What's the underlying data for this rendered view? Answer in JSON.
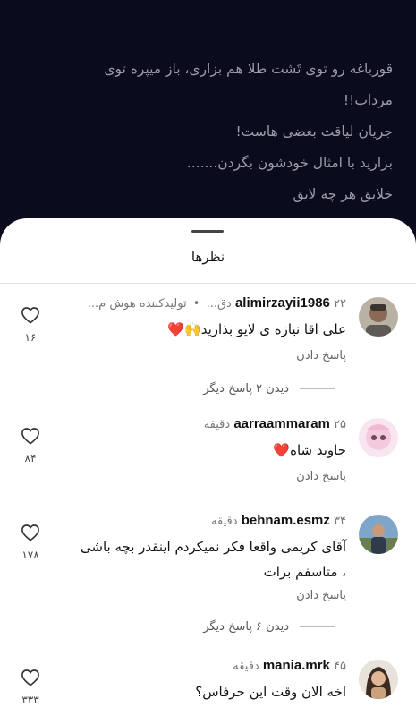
{
  "post": {
    "caption_lines": [
      "قورباغه رو توی تَشت طلا هم بزاری، باز میپره توی",
      "مرداب!!",
      "جریان لیاقت بعضی هاست!",
      "بزارید با امثال خودشون بگردن.......",
      "خلایق هر چه لایق"
    ]
  },
  "sheet": {
    "title": "نظرها"
  },
  "comments": [
    {
      "username": "alimirzayii1986",
      "time": "۲۲ دق...",
      "badge": "تولیدکننده هوش م...",
      "text": "علی اقا نیازه ی لایو بذارید🙌❤️",
      "reply_label": "پاسخ دادن",
      "likes": "۱۶",
      "more_replies": "دیدن ۲ پاسخ دیگر"
    },
    {
      "username": "aarraammaram",
      "time": "۲۵ دقیقه",
      "text": "جاوید شاه❤️",
      "reply_label": "پاسخ دادن",
      "likes": "۸۴"
    },
    {
      "username": "behnam.esmz",
      "time": "۳۴ دقیقه",
      "text": "آقای کریمی واقعا فکر نمیکردم اینقدر بچه باشی ، متاسفم برات",
      "reply_label": "پاسخ دادن",
      "likes": "۱۷۸",
      "more_replies": "دیدن ۶ پاسخ دیگر"
    },
    {
      "username": "mania.mrk",
      "time": "۴۵ دقیقه",
      "text": "اخه الان وقت این حرفاس؟",
      "likes": "۳۳۳"
    }
  ],
  "colors": {
    "background": "#0b0b1e",
    "sheet": "#ffffff",
    "heart": "#e0245e"
  },
  "icons": {
    "like": "heart-outline-icon"
  }
}
